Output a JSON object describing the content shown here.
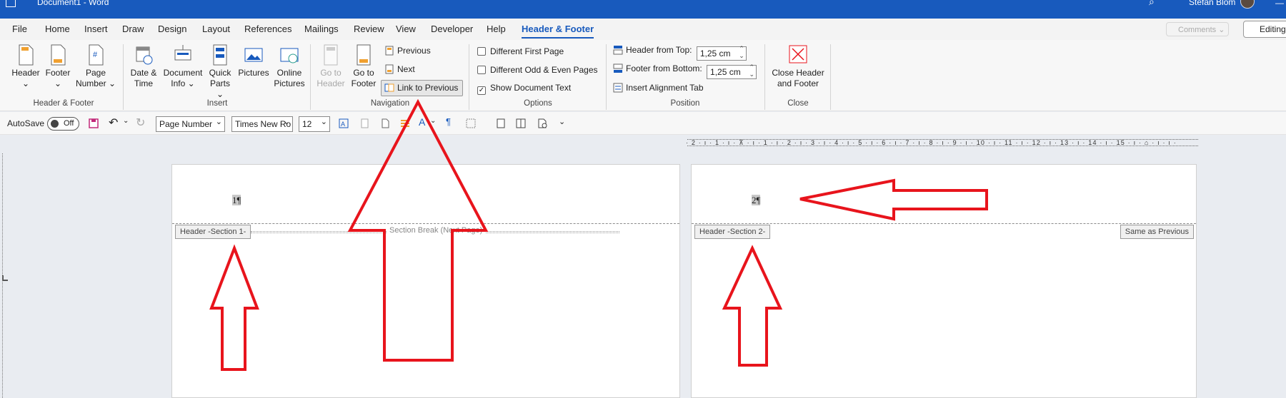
{
  "title_bar": {
    "document": "Document1 - Word",
    "user": "Stefan Blom"
  },
  "menu": {
    "tabs": [
      "File",
      "Home",
      "Insert",
      "Draw",
      "Design",
      "Layout",
      "References",
      "Mailings",
      "Review",
      "View",
      "Developer",
      "Help",
      "Header & Footer"
    ],
    "active_tab": "Header & Footer",
    "comments": "Comments",
    "editing": "Editing"
  },
  "ribbon": {
    "groups": {
      "header_footer": "Header & Footer",
      "insert": "Insert",
      "navigation": "Navigation",
      "options": "Options",
      "position": "Position",
      "close": "Close"
    },
    "header": [
      "Header",
      "⌄"
    ],
    "footer": [
      "Footer",
      "⌄"
    ],
    "page_number": [
      "Page",
      "Number ⌄"
    ],
    "date_time": [
      "Date &",
      "Time"
    ],
    "document_info": [
      "Document",
      "Info ⌄"
    ],
    "quick_parts": [
      "Quick",
      "Parts ⌄"
    ],
    "pictures": "Pictures",
    "online_pictures": [
      "Online",
      "Pictures"
    ],
    "go_to_header": [
      "Go to",
      "Header"
    ],
    "go_to_footer": [
      "Go to",
      "Footer"
    ],
    "previous": "Previous",
    "next": "Next",
    "link_to_previous": "Link to Previous",
    "different_first_page": "Different First Page",
    "different_odd_even": "Different Odd & Even Pages",
    "show_document_text": "Show Document Text",
    "header_from_top": "Header from Top:",
    "header_from_top_value": "1,25 cm",
    "footer_from_bottom": "Footer from Bottom:",
    "footer_from_bottom_value": "1,25 cm",
    "insert_alignment_tab": "Insert Alignment Tab",
    "close_header_footer": [
      "Close Header",
      "and Footer"
    ],
    "show_document_text_checked": true
  },
  "qat": {
    "autosave": "AutoSave",
    "autosave_state": "Off",
    "style": "Page Number",
    "font": "Times New Ro",
    "size": "12"
  },
  "ruler": {
    "text": "· 2 · ı · 1 · ı · ⊼ · ı · 1 · ı · 2 · ı · 3 · ı · 4 · ı · 5 · ı · 6 · ı · 7 · ı · 8 · ı · 9 · ı · 10 · ı · 11 · ı · 12 · ı · 13 · ı · 14 · ı · 15 · ı · ⌂ · ı · ı ·"
  },
  "pages": [
    {
      "number_text": "1¶",
      "header_tag": "Header -Section 1-",
      "section_break": "Section Break (Next Page)"
    },
    {
      "number_text": "2¶",
      "header_tag": "Header -Section 2-",
      "same_as_previous": "Same as Previous"
    }
  ],
  "colors": {
    "title_bar": "#185abd",
    "accent": "#185abd",
    "annotation": "#e8141c"
  }
}
